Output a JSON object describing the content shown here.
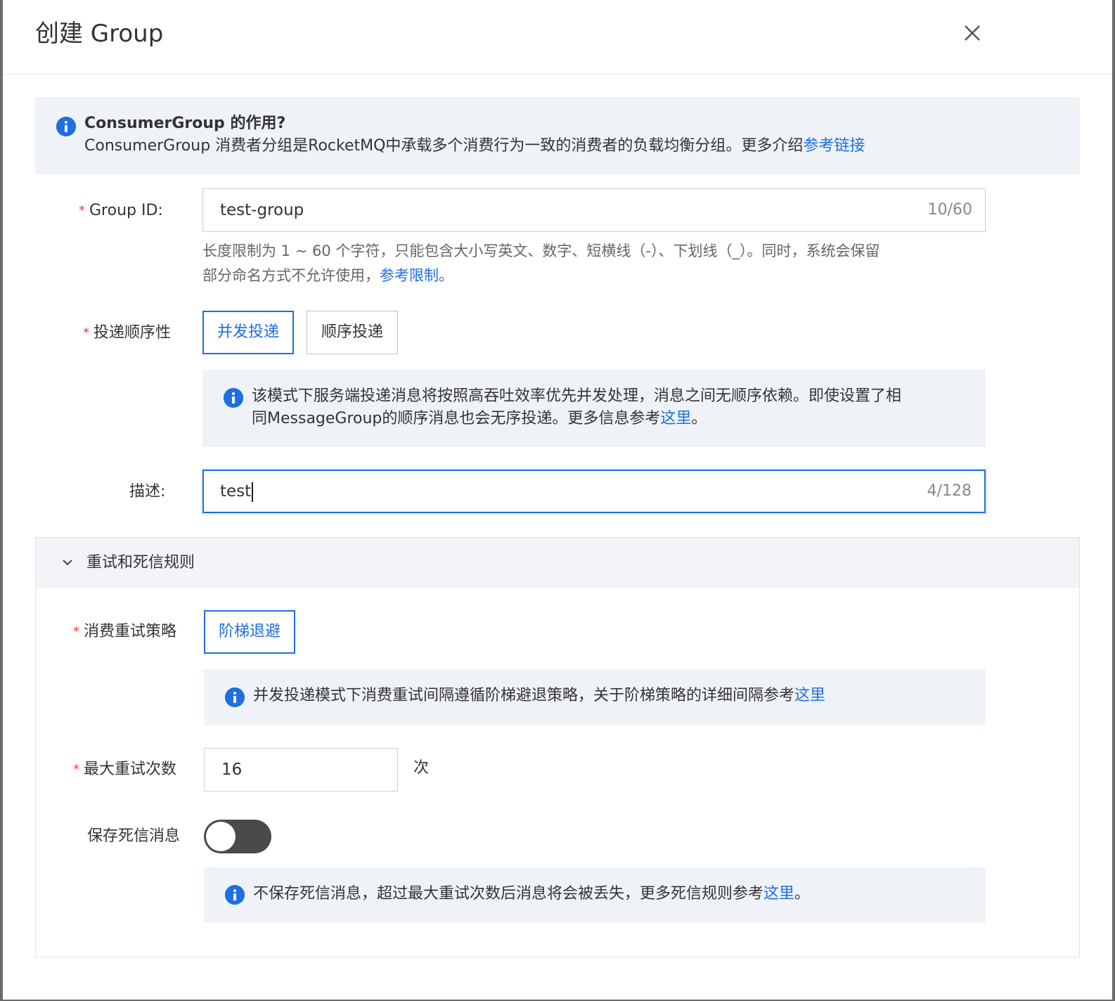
{
  "dialog": {
    "title": "创建 Group"
  },
  "intro": {
    "heading": "ConsumerGroup 的作用?",
    "text": "ConsumerGroup 消费者分组是RocketMQ中承载多个消费行为一致的消费者的负载均衡分组。更多介绍",
    "link": "参考链接"
  },
  "group_id": {
    "label": "Group ID:",
    "value": "test-group",
    "counter": "10/60",
    "help_line1": "长度限制为 1 ~ 60 个字符，只能包含大小写英文、数字、短横线（-）、下划线（_）。同时，系统会保留",
    "help_line2": "部分命名方式不允许使用，",
    "help_link": "参考限制",
    "help_end": "。"
  },
  "delivery": {
    "label": "投递顺序性",
    "options": [
      "并发投递",
      "顺序投递"
    ],
    "selected": "并发投递",
    "info_line1": "该模式下服务端投递消息将按照高吞吐效率优先并发处理，消息之间无顺序依赖。即使设置了相",
    "info_line2": "同MessageGroup的顺序消息也会无序投递。更多信息参考",
    "info_link": "这里",
    "info_end": "。"
  },
  "description": {
    "label": "描述:",
    "value": "test",
    "counter": "4/128"
  },
  "retry_section": {
    "title": "重试和死信规则",
    "strategy": {
      "label": "消费重试策略",
      "option": "阶梯退避",
      "info": "并发投递模式下消费重试间隔遵循阶梯避退策略，关于阶梯策略的详细间隔参考",
      "info_link": "这里"
    },
    "max_retries": {
      "label": "最大重试次数",
      "value": "16",
      "unit": "次"
    },
    "dead_letter": {
      "label": "保存死信消息",
      "enabled": false,
      "info": "不保存死信消息，超过最大重试次数后消息将会被丢失，更多死信规则参考",
      "info_link": "这里",
      "info_end": "。"
    }
  },
  "colors": {
    "accent": "#1f6fe0",
    "required": "#e5443a",
    "info_bg": "#eff3f8"
  }
}
